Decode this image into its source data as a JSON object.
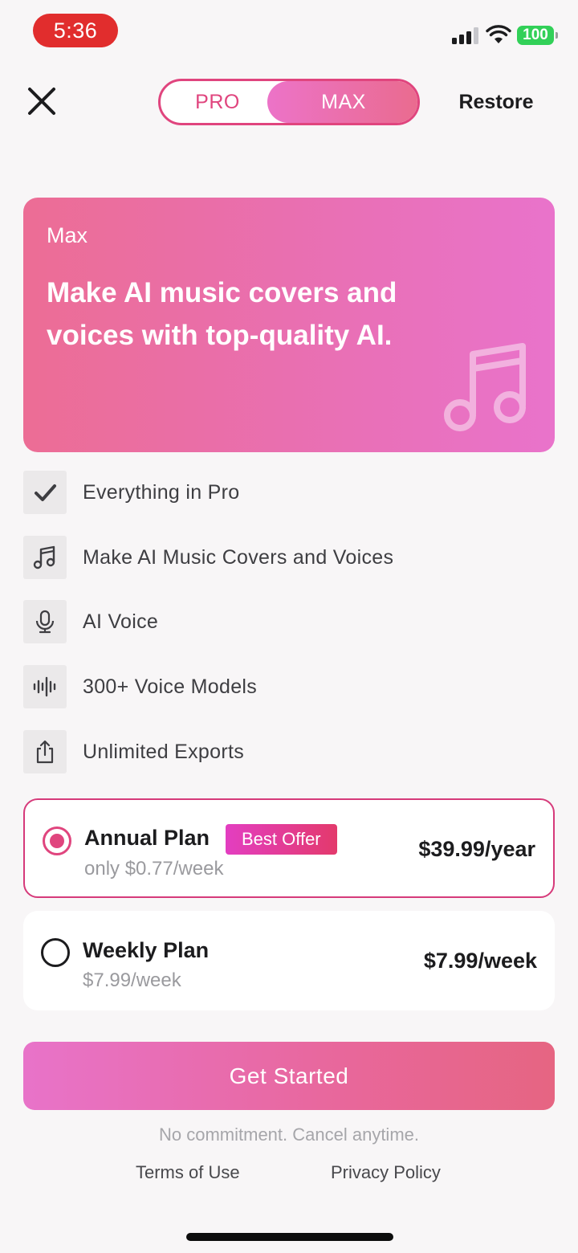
{
  "status_bar": {
    "time": "5:36",
    "battery": "100"
  },
  "header": {
    "tabs": [
      {
        "label": "PRO",
        "selected": false
      },
      {
        "label": "MAX",
        "selected": true
      }
    ],
    "restore_label": "Restore"
  },
  "hero": {
    "eyebrow": "Max",
    "title": "Make AI music covers and voices with top-quality AI.",
    "icon": "music-note-icon"
  },
  "features": [
    {
      "icon": "checkmark-icon",
      "label": "Everything in Pro"
    },
    {
      "icon": "music-note-icon",
      "label": "Make AI Music Covers and Voices"
    },
    {
      "icon": "microphone-icon",
      "label": "AI Voice"
    },
    {
      "icon": "waveform-icon",
      "label": "300+ Voice Models"
    },
    {
      "icon": "share-icon",
      "label": "Unlimited Exports"
    }
  ],
  "plans": [
    {
      "name": "Annual Plan",
      "badge": "Best Offer",
      "subtitle": "only $0.77/week",
      "price": "$39.99/year",
      "selected": true
    },
    {
      "name": "Weekly Plan",
      "subtitle": "$7.99/week",
      "price": "$7.99/week",
      "selected": false
    }
  ],
  "cta_label": "Get Started",
  "disclaimer": "No commitment. Cancel anytime.",
  "links": {
    "terms": "Terms of Use",
    "privacy": "Privacy Policy"
  },
  "colors": {
    "accent": "#e0457e",
    "gradient_start": "#ec6d95",
    "gradient_end": "#e973cb"
  }
}
